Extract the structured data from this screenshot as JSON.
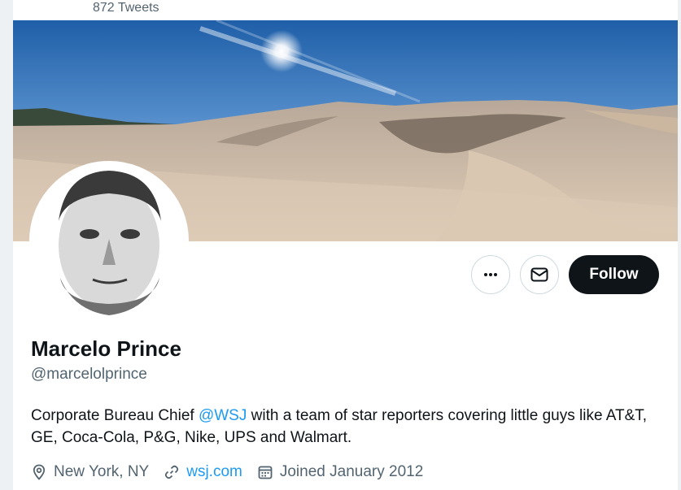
{
  "header": {
    "tweet_count": "872 Tweets"
  },
  "profile": {
    "name": "Marcelo Prince",
    "handle": "@marcelolprince",
    "bio": {
      "before_mention": "Corporate Bureau Chief ",
      "mention": "@WSJ",
      "after_mention": " with a team of star reporters covering little guys like AT&T, GE, Coca-Cola, P&G, Nike, UPS and Walmart."
    },
    "location": "New York, NY",
    "website": "wsj.com",
    "joined": "Joined January 2012"
  },
  "actions": {
    "more_icon": "more-dots-icon",
    "message_icon": "envelope-icon",
    "follow_label": "Follow"
  },
  "colors": {
    "link": "#1d9bf0",
    "follow_bg": "#0f1419",
    "muted_text": "#536471"
  }
}
